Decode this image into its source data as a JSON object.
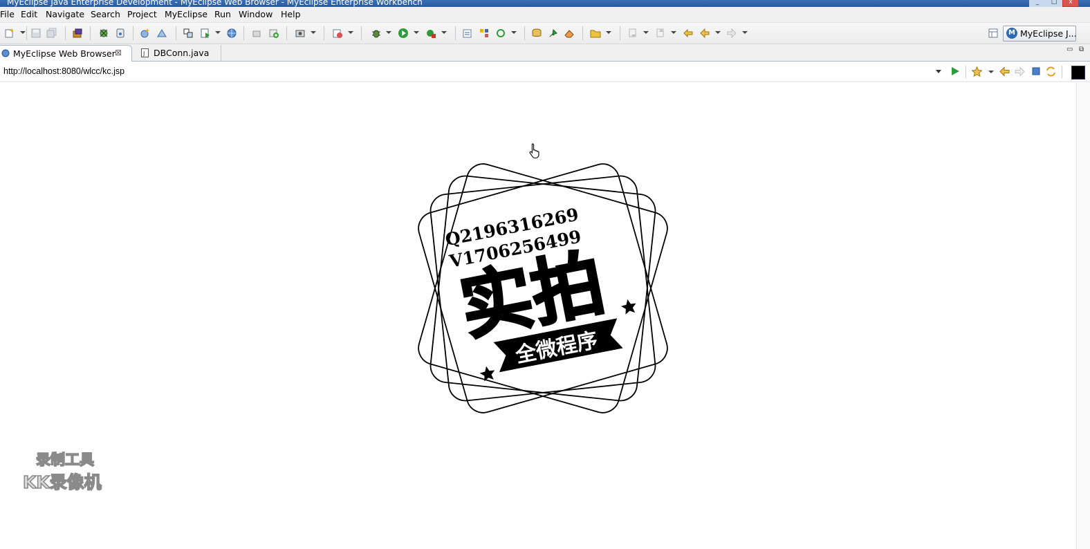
{
  "window": {
    "title": "MyEclipse Java Enterprise Development - MyEclipse Web Browser - MyEclipse Enterprise Workbench"
  },
  "menu": {
    "items": [
      "File",
      "Edit",
      "Navigate",
      "Search",
      "Project",
      "MyEclipse",
      "Run",
      "Window",
      "Help"
    ]
  },
  "toolbar": {
    "perspective_label": "MyEclipse J..."
  },
  "tabs": [
    {
      "label": "MyEclipse Web Browser",
      "active": true
    },
    {
      "label": "DBConn.java",
      "active": false
    }
  ],
  "browser": {
    "url": "http://localhost:8080/wlcc/kc.jsp"
  },
  "page": {
    "stamp": {
      "line1": "Q2196316269",
      "line2": "V1706256499",
      "headline": "实拍",
      "ribbon": "全微程序"
    }
  },
  "watermark": {
    "line1": "录制工具",
    "line2": "KK录像机"
  }
}
